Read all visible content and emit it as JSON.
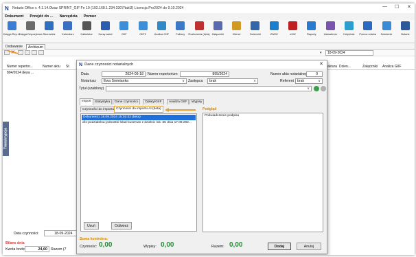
{
  "window": {
    "app_logo": "N",
    "title": "Notaris Office v. 4.1.14.0fzaz SPRINT_GIF Fe 19 (192.168.1.234:3307/taki3) Licencja Pro2024 do 9.10.2024"
  },
  "menu": [
    "Dokument",
    "Przejdź do ...",
    "Narzędzia",
    "Pomoc"
  ],
  "ribbon": [
    {
      "label": "Księga Rep. A",
      "color": "#3a7bd5"
    },
    {
      "label": "Księga Depozytowa",
      "color": "#6a6a6a"
    },
    {
      "label": "Skorowidz",
      "color": "#2f6fc0"
    },
    {
      "label": "Kalendarz",
      "color": "#3b6fc4"
    },
    {
      "label": "Kalkulator",
      "color": "#555555"
    },
    {
      "label": "Kursy walut",
      "color": "#2a5db0"
    },
    {
      "label": "GIIF",
      "color": "#3d8ed8"
    },
    {
      "label": "GIIF2",
      "color": "#3d8ed8"
    },
    {
      "label": "Analiza GIIF",
      "color": "#2f8ac8"
    },
    {
      "label": "Faktury",
      "color": "#3c78c8"
    },
    {
      "label": "Rozliczenia (beta)",
      "color": "#c03030"
    },
    {
      "label": "Załączniki",
      "color": "#5a6ab0"
    },
    {
      "label": "Klienci",
      "color": "#d09a20"
    },
    {
      "label": "Dzienniki",
      "color": "#3366aa"
    },
    {
      "label": "WWW",
      "color": "#1b7fd0"
    },
    {
      "label": "eKW",
      "color": "#c02020"
    },
    {
      "label": "Raporty",
      "color": "#2a7ad0"
    },
    {
      "label": "Ustawienia",
      "color": "#7a55b0"
    },
    {
      "label": "Helpdesk",
      "color": "#2a9fd0"
    },
    {
      "label": "Pomoc zdalna",
      "color": "#2a6ac0"
    },
    {
      "label": "Szkolenie",
      "color": "#3a8ad8"
    },
    {
      "label": "Notaris",
      "color": "#2a5a9a"
    }
  ],
  "subtabs": [
    "Dodawanie",
    "Archiwum"
  ],
  "date_filter": "18-09-2024",
  "grid": {
    "headers_left": [
      "Numer repertor...",
      "Numer aktu",
      "St"
    ],
    "headers_right": [
      "Faktura",
      "Dzien...",
      "Załączniki",
      "Analiza GIIF"
    ],
    "row": [
      "894/2024 (Ewa ..."
    ]
  },
  "side_tab": "Transkrypcja",
  "bottom": {
    "data_label": "Data czynności:",
    "data_value": "18-09-2024",
    "oplaty_label": "Bilans dnia",
    "kwota_label": "Kwota brutto",
    "kwota_value": "24,60",
    "razem_label": "Razem (7"
  },
  "dialog": {
    "title_logo": "N",
    "title": "Dane czynności notarialnych",
    "data_label": "Data",
    "data_value": "2024-09-18",
    "numer_rep_label": "Numer repertorium",
    "numer_rep_value": "895/2024",
    "numer_aktu_label": "Numer aktu notarialnego",
    "numer_aktu_value": "0",
    "notariusz_label": "Notariusz",
    "notariusz_value": "Ewa Śmietanka",
    "zastepca_label": "Zastępca",
    "zastepca_value": "brak",
    "referent_label": "Referent",
    "referent_value": "brak",
    "tytul_label": "Tytuł (szablony)",
    "tabs": [
      "Import",
      "Statystyka",
      "Dane czynności",
      "Opłaty/GIIF",
      "Analiza GIIF",
      "Wypisy"
    ],
    "subtabs": [
      "Czynności do importu",
      "Czynności do importu AI (beta)"
    ],
    "list_selected": "Dokument1 18.09.2024 15:02:32 (beta)",
    "list_item": "af1-podziałelna-jednostki-lokal-kuszman z dzielnic lok. 65 dnia 17.09.202...",
    "podglad_label": "Podgląd",
    "podglad_text": "Poświadczenie podpisu",
    "btn_usun": "Usuń",
    "btn_odswiez": "Odśwież",
    "suma_label": "Suma kontrolna:",
    "czynnosc_label": "Czynność:",
    "czynnosc_value": "0,00",
    "wypisy_label": "Wypisy:",
    "wypisy_value": "0,00",
    "razem_label": "Razem:",
    "razem_value": "0,00",
    "btn_dodaj": "Dodaj",
    "btn_anuluj": "Anuluj"
  }
}
